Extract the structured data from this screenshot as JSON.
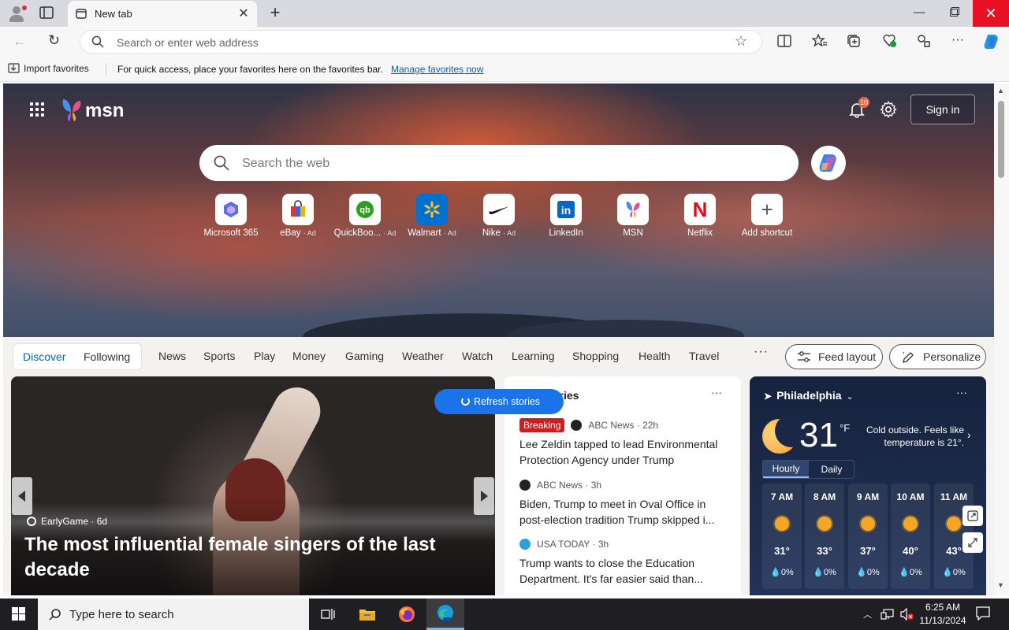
{
  "browser": {
    "tab_title": "New tab",
    "address_placeholder": "Search or enter web address"
  },
  "favorites_bar": {
    "import_label": "Import favorites",
    "message": "For quick access, place your favorites here on the favorites bar.",
    "manage_link": "Manage favorites now"
  },
  "msn": {
    "logo_text": "msn",
    "notification_count": "10",
    "sign_in_label": "Sign in",
    "search_placeholder": "Search the web",
    "shortcuts": [
      {
        "label": "Microsoft 365",
        "ad": ""
      },
      {
        "label": "eBay",
        "ad": "· Ad"
      },
      {
        "label": "QuickBoo...",
        "ad": "· Ad"
      },
      {
        "label": "Walmart",
        "ad": "· Ad"
      },
      {
        "label": "Nike",
        "ad": "· Ad"
      },
      {
        "label": "LinkedIn",
        "ad": ""
      },
      {
        "label": "MSN",
        "ad": ""
      },
      {
        "label": "Netflix",
        "ad": ""
      },
      {
        "label": "Add shortcut",
        "ad": ""
      }
    ]
  },
  "feed_nav": {
    "discover": "Discover",
    "following": "Following",
    "items": [
      "News",
      "Sports",
      "Play",
      "Money",
      "Gaming",
      "Weather",
      "Watch",
      "Learning",
      "Shopping",
      "Health",
      "Travel"
    ],
    "more": "···",
    "feed_layout": "Feed layout",
    "personalize": "Personalize"
  },
  "hero_story": {
    "source": "EarlyGame",
    "age": "· 6d",
    "headline": "The most influential female singers of the last decade"
  },
  "refresh_label": "Refresh stories",
  "top_stories": {
    "heading": "Top stories",
    "items": [
      {
        "badge": "Breaking",
        "publisher": "ABC News",
        "age": "· 22h",
        "title": "Lee Zeldin tapped to lead Environmental Protection Agency under Trump"
      },
      {
        "badge": "",
        "publisher": "ABC News",
        "age": "· 3h",
        "title": "Biden, Trump to meet in Oval Office in post-election tradition Trump skipped i..."
      },
      {
        "badge": "",
        "publisher": "USA TODAY",
        "age": "· 3h",
        "title": "Trump wants to close the Education Department. It's far easier said than..."
      }
    ]
  },
  "weather": {
    "city": "Philadelphia",
    "temperature": "31",
    "unit": "°F",
    "description": "Cold outside. Feels like temperature is 21°.",
    "tab_hourly": "Hourly",
    "tab_daily": "Daily",
    "hourly": [
      {
        "time": "7 AM",
        "temp": "31°",
        "precip": "💧0%"
      },
      {
        "time": "8 AM",
        "temp": "33°",
        "precip": "💧0%"
      },
      {
        "time": "9 AM",
        "temp": "37°",
        "precip": "💧0%"
      },
      {
        "time": "10 AM",
        "temp": "40°",
        "precip": "💧0%"
      },
      {
        "time": "11 AM",
        "temp": "43°",
        "precip": "💧0%"
      }
    ]
  },
  "taskbar": {
    "search_placeholder": "Type here to search",
    "time": "6:25 AM",
    "date": "11/13/2024"
  }
}
